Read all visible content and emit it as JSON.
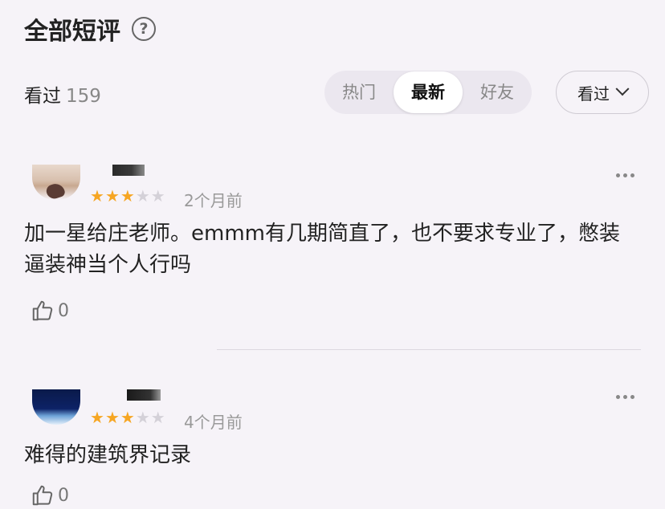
{
  "header": {
    "title": "全部短评",
    "help_icon": "question-circle-icon"
  },
  "summary": {
    "label": "看过",
    "count": "159"
  },
  "tabs": [
    {
      "label": "热门",
      "active": false
    },
    {
      "label": "最新",
      "active": true
    },
    {
      "label": "好友",
      "active": false
    }
  ],
  "filter": {
    "label": "看过"
  },
  "colors": {
    "star": "#f6a623",
    "star_empty": "#d4d1d8",
    "background": "#f6f3f8"
  },
  "comments": [
    {
      "rating": 3,
      "max_rating": 5,
      "time": "2个月前",
      "text": "加一星给庄老师。emmm有几期简直了，也不要求专业了，憋装逼装神当个人行吗",
      "likes": "0"
    },
    {
      "rating": 3,
      "max_rating": 5,
      "time": "4个月前",
      "text": "难得的建筑界记录",
      "likes": "0"
    }
  ]
}
